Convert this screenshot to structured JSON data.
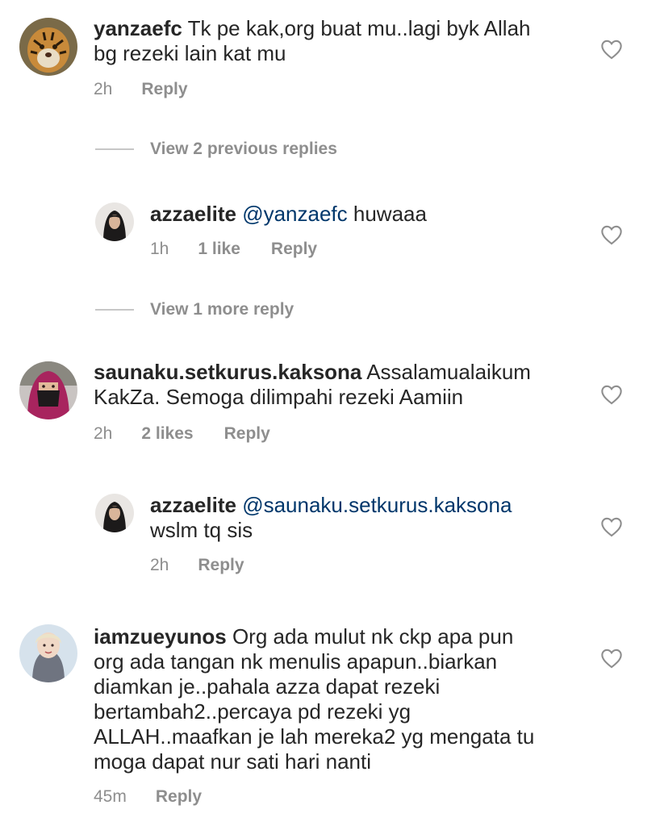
{
  "comments": [
    {
      "username": "yanzaefc",
      "text": "Tk pe kak,org buat mu..lagi byk Allah bg rezeki lain kat mu",
      "line1": "Tk pe kak,org buat mu..lagi byk Allah",
      "line2": "bg rezeki lain kat mu",
      "time": "2h",
      "reply_label": "Reply",
      "avatar_icon": "tiger-avatar"
    },
    {
      "username": "azzaelite",
      "mention": "@yanzaefc",
      "text": "huwaaa",
      "time": "1h",
      "likes": "1 like",
      "reply_label": "Reply",
      "avatar_icon": "woman-hijab-avatar"
    },
    {
      "username": "saunaku.setkurus.kaksona",
      "line1": "Assalamualaikum",
      "line2": "KakZa. Semoga dilimpahi rezeki Aamiin",
      "time": "2h",
      "likes": "2 likes",
      "reply_label": "Reply",
      "avatar_icon": "niqab-avatar"
    },
    {
      "username": "azzaelite",
      "mention": "@saunaku.setkurus.kaksona",
      "line2": "wslm tq sis",
      "time": "2h",
      "reply_label": "Reply",
      "avatar_icon": "woman-hijab-avatar"
    },
    {
      "username": "iamzueyunos",
      "line1": "Org ada mulut nk ckp apa pun",
      "line2": "org ada tangan nk menulis apapun..biarkan",
      "line3": "diamkan je..pahala azza dapat rezeki",
      "line4": "bertambah2..percaya pd rezeki yg",
      "line5": "ALLAH..maafkan je lah mereka2 yg mengata tu",
      "line6": "moga dapat nur sati hari nanti",
      "time": "45m",
      "reply_label": "Reply",
      "avatar_icon": "woman-avatar"
    }
  ],
  "view_replies": {
    "previous": "View 2 previous replies",
    "more": "View 1 more reply"
  },
  "colors": {
    "text": "#262626",
    "meta": "#8e8e8e",
    "mention": "#00376b",
    "divider": "#c7c7c7"
  }
}
